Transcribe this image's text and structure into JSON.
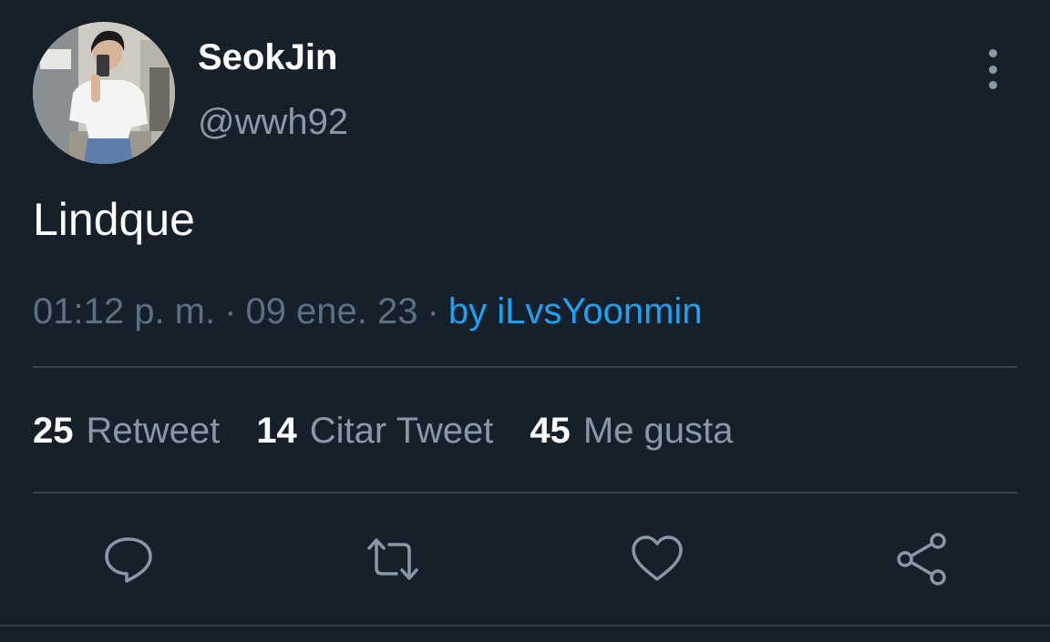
{
  "tweet": {
    "author": {
      "display_name": "SeokJin",
      "handle": "@wwh92"
    },
    "text": "Lindque",
    "timestamp": {
      "time": "01:12 p. m.",
      "date": "09 ene. 23",
      "separator": "·",
      "source": "by iLvsYoonmin"
    },
    "stats": {
      "retweets": {
        "count": "25",
        "label": "Retweet"
      },
      "quotes": {
        "count": "14",
        "label": "Citar Tweet"
      },
      "likes": {
        "count": "45",
        "label": "Me gusta"
      }
    },
    "actions": {
      "icons": [
        "reply-icon",
        "retweet-icon",
        "like-icon",
        "share-icon"
      ]
    }
  },
  "colors": {
    "background": "#15202b",
    "text_primary": "#ffffff",
    "text_secondary": "#8899a6",
    "text_muted": "#5b7083",
    "accent": "#1da1f2",
    "divider": "#38444d"
  }
}
